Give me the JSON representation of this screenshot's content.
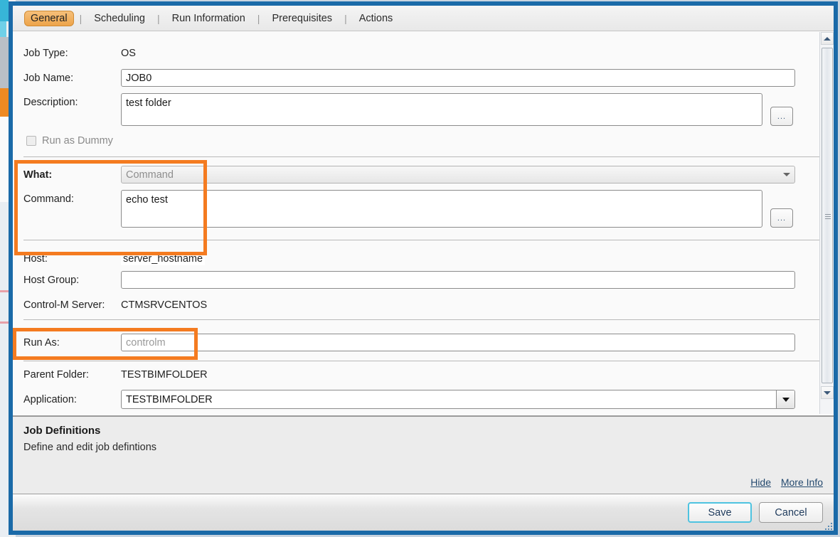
{
  "window": {
    "border_color": "#1a6aa8"
  },
  "tabs": [
    {
      "label": "General",
      "active": true
    },
    {
      "label": "Scheduling",
      "active": false
    },
    {
      "label": "Run Information",
      "active": false
    },
    {
      "label": "Prerequisites",
      "active": false
    },
    {
      "label": "Actions",
      "active": false
    }
  ],
  "tab_separator": "|",
  "form": {
    "job_type": {
      "label": "Job Type:",
      "value": "OS"
    },
    "job_name": {
      "label": "Job Name:",
      "value": "JOB0"
    },
    "description": {
      "label": "Description:",
      "value": "test folder",
      "browse_button": "..."
    },
    "run_as_dummy": {
      "label": "Run as Dummy",
      "checked": false,
      "disabled": true
    },
    "what": {
      "label": "What:",
      "value": "Command"
    },
    "command": {
      "label": "Command:",
      "value": "echo test",
      "browse_button": "..."
    },
    "host": {
      "label": "Host:",
      "value": "server_hostname"
    },
    "host_group": {
      "label": "Host Group:",
      "value": ""
    },
    "controlm_server": {
      "label": "Control-M Server:",
      "value": "CTMSRVCENTOS"
    },
    "run_as": {
      "label": "Run As:",
      "value": "controlm"
    },
    "parent_folder": {
      "label": "Parent Folder:",
      "value": "TESTBIMFOLDER"
    },
    "application": {
      "label": "Application:",
      "value": "TESTBIMFOLDER"
    }
  },
  "highlights": {
    "color": "#f47b20",
    "regions": [
      "what-command-section",
      "run-as-field"
    ]
  },
  "info_panel": {
    "title": "Job Definitions",
    "subtitle": "Define and edit job defintions",
    "hide_link": "Hide",
    "more_info_link": "More Info"
  },
  "footer": {
    "save_label": "Save",
    "cancel_label": "Cancel"
  },
  "icons": {
    "dropdown": "chevron-down-icon",
    "scroll_up": "scroll-up-arrow-icon",
    "scroll_down": "scroll-down-arrow-icon",
    "resize": "resize-grip-icon"
  }
}
